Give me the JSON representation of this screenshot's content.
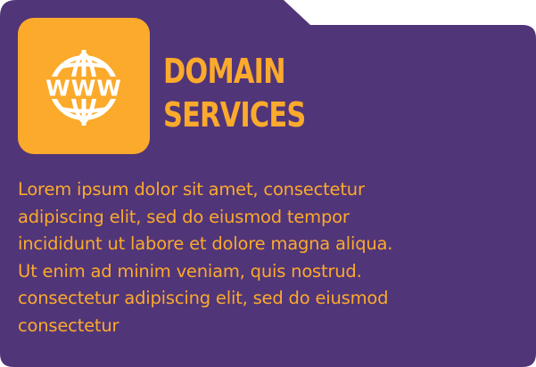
{
  "colors": {
    "card_background": "#513579",
    "accent": "#fbaa2b",
    "icon_foreground": "#ffffff"
  },
  "icon": {
    "name": "globe-www-icon",
    "text": "WWW"
  },
  "title": {
    "line1": "DOMAIN",
    "line2": "SERVICES"
  },
  "description": {
    "lines": [
      "Lorem ipsum dolor sit amet, consectetur",
      "adipiscing elit, sed do eiusmod tempor",
      "incididunt ut labore et dolore magna aliqua.",
      "Ut enim ad minim veniam, quis nostrud.",
      "consectetur adipiscing elit, sed do eiusmod",
      "consectetur"
    ]
  }
}
